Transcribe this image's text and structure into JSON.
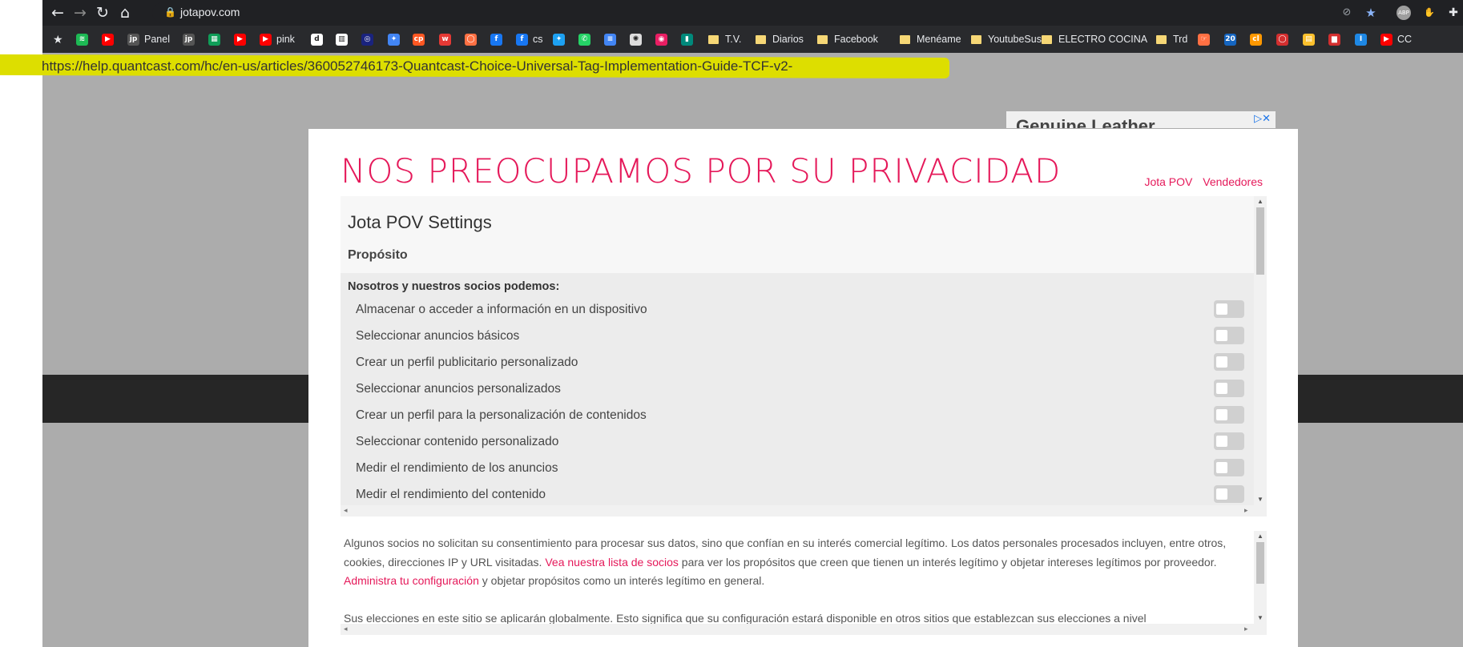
{
  "browser": {
    "url": "jotapov.com",
    "lock_icon": "lock-icon",
    "bookmarks": [
      {
        "label": "",
        "icon": "spotify-icon",
        "color": "#1db954"
      },
      {
        "label": "",
        "icon": "youtube-icon",
        "color": "#ff0000"
      },
      {
        "label": "Panel",
        "icon": "jpov-icon",
        "color": "#555555"
      },
      {
        "label": "",
        "icon": "jpov-icon",
        "color": "#555555"
      },
      {
        "label": "",
        "icon": "sheets-icon",
        "color": "#0f9d58"
      },
      {
        "label": "",
        "icon": "youtube-icon",
        "color": "#ff0000"
      },
      {
        "label": "pink",
        "icon": "youtube-icon",
        "color": "#ff0000"
      },
      {
        "label": "",
        "icon": "d-icon",
        "color": "#ffffff"
      },
      {
        "label": "",
        "icon": "chart-icon",
        "color": "#ffffff"
      },
      {
        "label": "",
        "icon": "blue-circle-icon",
        "color": "#1a237e"
      },
      {
        "label": "",
        "icon": "colorful-icon",
        "color": "#4285f4"
      },
      {
        "label": "",
        "icon": "cp-icon",
        "color": "#ff5722"
      },
      {
        "label": "",
        "icon": "w-icon",
        "color": "#e53935"
      },
      {
        "label": "",
        "icon": "ring-icon",
        "color": "#ff7043"
      },
      {
        "label": "",
        "icon": "facebook-icon",
        "color": "#1877f2"
      },
      {
        "label": "cs",
        "icon": "facebook-icon",
        "color": "#1877f2"
      },
      {
        "label": "",
        "icon": "twitter-icon",
        "color": "#1da1f2"
      },
      {
        "label": "",
        "icon": "whatsapp-icon",
        "color": "#25d366"
      },
      {
        "label": "",
        "icon": "docs-icon",
        "color": "#4285f4"
      },
      {
        "label": "",
        "icon": "chatgpt-icon",
        "color": "#dddddd"
      },
      {
        "label": "",
        "icon": "pink-circle-icon",
        "color": "#e91e63"
      },
      {
        "label": "",
        "icon": "teal-icon",
        "color": "#00897b"
      },
      {
        "label": "T.V.",
        "icon": "folder-icon",
        "color": "#f6d776"
      },
      {
        "label": "Diarios",
        "icon": "folder-icon",
        "color": "#f6d776"
      },
      {
        "label": "Facebook",
        "icon": "folder-icon",
        "color": "#f6d776"
      },
      {
        "label": "Menéame",
        "icon": "folder-icon",
        "color": "#f6d776"
      },
      {
        "label": "YoutubeSus",
        "icon": "folder-icon",
        "color": "#f6d776"
      },
      {
        "label": "ELECTRO COCINA",
        "icon": "folder-icon",
        "color": "#f6d776"
      },
      {
        "label": "Trd",
        "icon": "folder-icon",
        "color": "#f6d776"
      },
      {
        "label": "",
        "icon": "hand-icon",
        "color": "#ff7043"
      },
      {
        "label": "",
        "icon": "20-icon",
        "color": "#1565c0"
      },
      {
        "label": "",
        "icon": "orange-icon",
        "color": "#ff9800"
      },
      {
        "label": "",
        "icon": "red-oval-icon",
        "color": "#d32f2f"
      },
      {
        "label": "",
        "icon": "striped-icon",
        "color": "#fbc02d"
      },
      {
        "label": "",
        "icon": "bars-icon",
        "color": "#d32f2f"
      },
      {
        "label": "",
        "icon": "i-icon",
        "color": "#1e88e5"
      },
      {
        "label": "CC",
        "icon": "youtube-icon",
        "color": "#ff0000"
      }
    ]
  },
  "annotation": {
    "url": "https://help.quantcast.com/hc/en-us/articles/360052746173-Quantcast-Choice-Universal-Tag-Implementation-Guide-TCF-v2-"
  },
  "ad": {
    "text": "Genuine Leather"
  },
  "modal": {
    "title": "NOS PREOCUPAMOS POR SU PRIVACIDAD",
    "links": [
      "Jota POV",
      "Vendedores"
    ],
    "settings_title": "Jota POV Settings",
    "section": "Propósito",
    "list_heading": "Nosotros y nuestros socios podemos:",
    "purposes": [
      "Almacenar o acceder a información en un dispositivo",
      "Seleccionar anuncios básicos",
      "Crear un perfil publicitario personalizado",
      "Seleccionar anuncios personalizados",
      "Crear un perfil para la personalización de contenidos",
      "Seleccionar contenido personalizado",
      "Medir el rendimiento de los anuncios",
      "Medir el rendimiento del contenido"
    ],
    "info": {
      "p1_a": "Algunos socios no solicitan su consentimiento para procesar sus datos, sino que confían en su interés comercial legítimo. Los datos personales procesados incluyen, entre otros, cookies, direcciones IP y URL visitadas.",
      "link1": "Vea nuestra lista de socios",
      "p1_b": "para ver los propósitos que creen que tienen un interés legítimo y objetar intereses legítimos por proveedor.",
      "link2": "Administra tu configuración",
      "p1_c": "y objetar propósitos como un interés legítimo en general.",
      "p2": "Sus elecciones en este sitio se aplicarán globalmente. Esto significa que su configuración estará disponible en otros sitios que establezcan sus elecciones a nivel"
    }
  }
}
